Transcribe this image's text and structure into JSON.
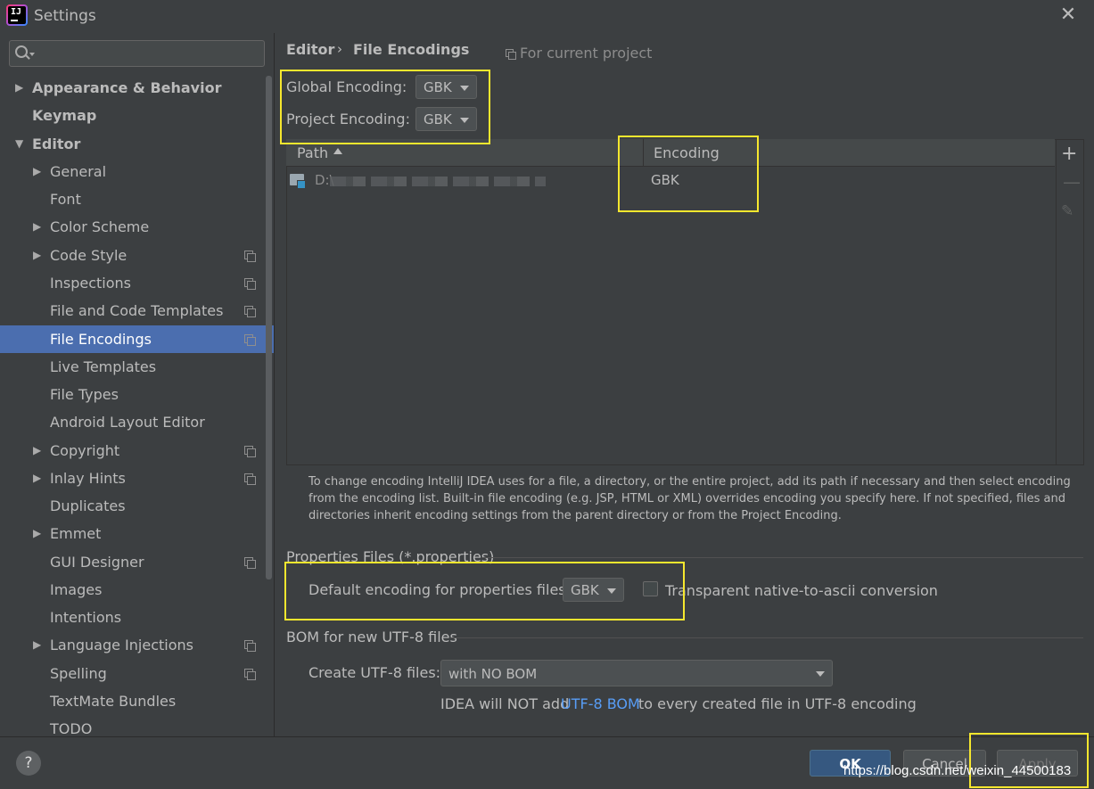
{
  "window": {
    "title": "Settings",
    "close": "✕"
  },
  "app_icon": {
    "text": "IJ"
  },
  "sidebar": {
    "items": [
      {
        "label": "Appearance & Behavior",
        "arrow": "▶"
      },
      {
        "label": "Keymap"
      },
      {
        "label": "Editor",
        "arrow": "▼"
      },
      {
        "label": "General",
        "arrow": "▶"
      },
      {
        "label": "Font"
      },
      {
        "label": "Color Scheme",
        "arrow": "▶"
      },
      {
        "label": "Code Style",
        "arrow": "▶"
      },
      {
        "label": "Inspections"
      },
      {
        "label": "File and Code Templates"
      },
      {
        "label": "File Encodings"
      },
      {
        "label": "Live Templates"
      },
      {
        "label": "File Types"
      },
      {
        "label": "Android Layout Editor"
      },
      {
        "label": "Copyright",
        "arrow": "▶"
      },
      {
        "label": "Inlay Hints",
        "arrow": "▶"
      },
      {
        "label": "Duplicates"
      },
      {
        "label": "Emmet",
        "arrow": "▶"
      },
      {
        "label": "GUI Designer"
      },
      {
        "label": "Images"
      },
      {
        "label": "Intentions"
      },
      {
        "label": "Language Injections",
        "arrow": "▶"
      },
      {
        "label": "Spelling"
      },
      {
        "label": "TextMate Bundles"
      },
      {
        "label": "TODO"
      }
    ],
    "selected": "File Encodings"
  },
  "breadcrumb": {
    "parent": "Editor",
    "separator": "›",
    "current": "File Encodings",
    "scope": "For current project"
  },
  "encodings": {
    "global_label": "Global Encoding:",
    "global_value": "GBK",
    "project_label": "Project Encoding:",
    "project_value": "GBK"
  },
  "table": {
    "headers": {
      "path": "Path",
      "encoding": "Encoding"
    },
    "rows": [
      {
        "path": "D:\\",
        "encoding": "GBK"
      }
    ],
    "toolbar": {
      "add": "+",
      "remove": "—",
      "edit": "✎"
    }
  },
  "help_text": "To change encoding IntelliJ IDEA uses for a file, a directory, or the entire project, add its path if necessary and then select encoding from the encoding list. Built-in file encoding (e.g. JSP, HTML or XML) overrides encoding you specify here. If not specified, files and directories inherit encoding settings from the parent directory or from the Project Encoding.",
  "properties": {
    "section_title": "Properties Files (*.properties)",
    "default_label": "Default encoding for properties files:",
    "default_value": "GBK",
    "transparent_label": "Transparent native-to-ascii conversion",
    "transparent_checked": false
  },
  "bom": {
    "section_title": "BOM for new UTF-8 files",
    "create_label": "Create UTF-8 files:",
    "create_value": "with NO BOM",
    "note_pre": "IDEA will NOT add",
    "note_link": "UTF-8 BOM",
    "note_post": "to every created file in UTF-8 encoding"
  },
  "buttons": {
    "help": "?",
    "ok": "OK",
    "cancel": "Cancel",
    "apply": "Apply"
  },
  "watermark": "https://blog.csdn.net/weixin_44500183",
  "colors": {
    "selection": "#4b6eaf",
    "highlight_box": "#f6e72e",
    "link": "#589df6",
    "ok_button": "#365880"
  }
}
